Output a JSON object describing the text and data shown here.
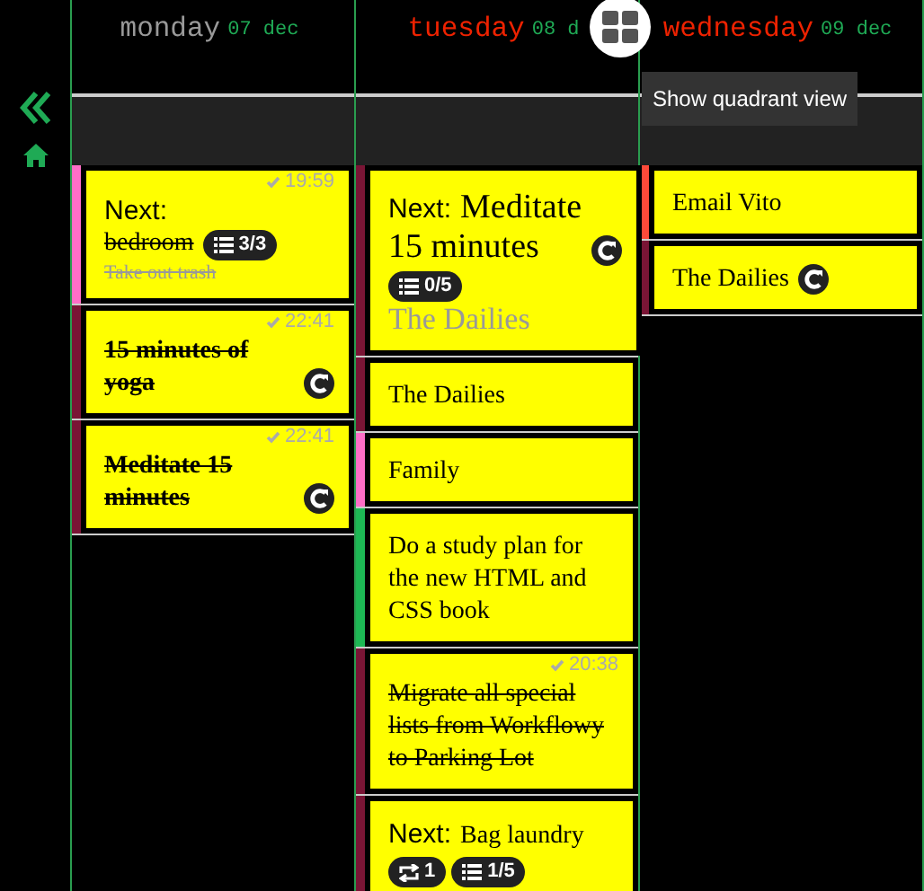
{
  "days": [
    {
      "name": "monday",
      "date": "07 dec",
      "past": true,
      "cards": [
        {
          "kind": "next",
          "color": "#ff6ec7",
          "prefix": "Next:",
          "title": "bedroom",
          "done": true,
          "time": "19:59",
          "badges": [
            {
              "kind": "list",
              "text": "3/3"
            }
          ],
          "footnote": {
            "text": "Take out trash",
            "done": true
          }
        },
        {
          "kind": "habit",
          "color": "#7a1535",
          "title": "15 minutes of yoga",
          "done": true,
          "time": "22:41",
          "repeat": true
        },
        {
          "kind": "habit",
          "color": "#7a1535",
          "title": "Meditate 15 minutes",
          "done": true,
          "time": "22:41",
          "repeat": true
        }
      ]
    },
    {
      "name": "tuesday",
      "date": "08 d",
      "past": false,
      "cards": [
        {
          "kind": "featured",
          "color": "#7a1535",
          "prefix": "Next:",
          "title": "Meditate 15 minutes",
          "done": false,
          "repeat": true,
          "badges": [
            {
              "kind": "list",
              "text": "0/5"
            }
          ],
          "footnote": {
            "text": "The Dailies",
            "done": false
          }
        },
        {
          "kind": "plain",
          "color": "#7a1535",
          "title": "The Dailies",
          "done": false
        },
        {
          "kind": "plain",
          "color": "#ff6ec7",
          "title": "Family",
          "done": false
        },
        {
          "kind": "plain",
          "color": "#1db954",
          "title": "Do a study plan for the new HTML and CSS book",
          "done": false
        },
        {
          "kind": "plain",
          "color": "#7a1535",
          "title": "Migrate all special lists from Workflowy to Parking Lot",
          "done": true,
          "time": "20:38"
        },
        {
          "kind": "inline-next",
          "color": "#7a1535",
          "prefix": "Next:",
          "title": "Bag laundry",
          "done": false,
          "badges": [
            {
              "kind": "repeat",
              "text": "1"
            },
            {
              "kind": "list",
              "text": "1/5"
            }
          ]
        }
      ]
    },
    {
      "name": "wednesday",
      "date": "09 dec",
      "past": false,
      "cards": [
        {
          "kind": "plain",
          "color": "#ff4a3a",
          "title": "Email Vito",
          "done": false
        },
        {
          "kind": "plain",
          "color": "#7a1535",
          "title": "The Dailies",
          "done": false,
          "repeat": true
        }
      ]
    }
  ],
  "tooltip": "Show quadrant view"
}
